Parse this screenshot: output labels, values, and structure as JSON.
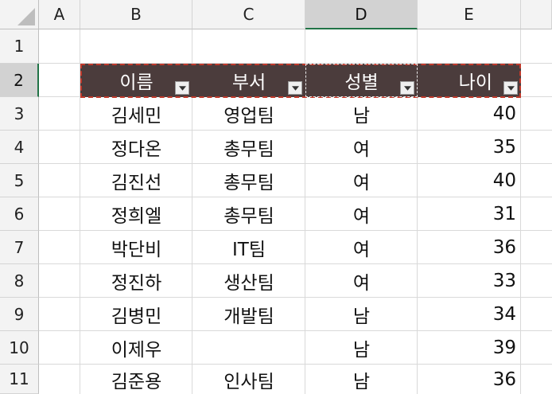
{
  "columns": [
    "A",
    "B",
    "C",
    "D",
    "E"
  ],
  "selected_column": "D",
  "selected_row": "2",
  "rows": [
    "1",
    "2",
    "3",
    "4",
    "5",
    "6",
    "7",
    "8",
    "9",
    "10",
    "11"
  ],
  "table": {
    "headers": [
      "이름",
      "부서",
      "성별",
      "나이"
    ],
    "header_fill": "#4b3c3c",
    "records": [
      {
        "name": "김세민",
        "dept": "영업팀",
        "gender": "남",
        "age": "40"
      },
      {
        "name": "정다온",
        "dept": "총무팀",
        "gender": "여",
        "age": "35"
      },
      {
        "name": "김진선",
        "dept": "총무팀",
        "gender": "여",
        "age": "40"
      },
      {
        "name": "정희엘",
        "dept": "총무팀",
        "gender": "여",
        "age": "31"
      },
      {
        "name": "박단비",
        "dept": "IT팀",
        "gender": "여",
        "age": "36"
      },
      {
        "name": "정진하",
        "dept": "생산팀",
        "gender": "여",
        "age": "33"
      },
      {
        "name": "김병민",
        "dept": "개발팀",
        "gender": "남",
        "age": "34"
      },
      {
        "name": "이제우",
        "dept": "",
        "gender": "남",
        "age": "39"
      },
      {
        "name": "김준용",
        "dept": "인사팀",
        "gender": "남",
        "age": "36"
      }
    ]
  },
  "icons": {
    "filter": "dropdown-arrow-icon",
    "select_all": "select-all-triangle-icon"
  },
  "colors": {
    "accent": "#217346",
    "copy_marquee": "#c0392b"
  }
}
